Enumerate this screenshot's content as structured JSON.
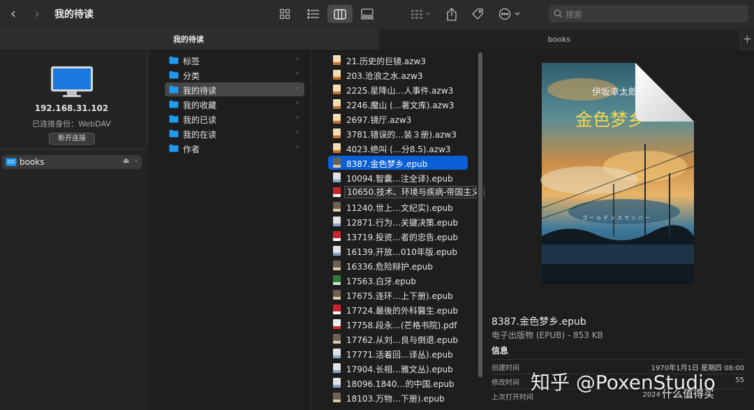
{
  "window": {
    "title": "我的待读"
  },
  "search": {
    "placeholder": "搜索"
  },
  "tabs": [
    {
      "label": "我的待读",
      "active": true
    },
    {
      "label": "books",
      "active": false
    }
  ],
  "sidebar": {
    "server": {
      "host": "192.168.31.102",
      "connected_as": "已连接身份：WebDAV",
      "disconnect_label": "断开连接"
    },
    "items": [
      {
        "label": "books",
        "selected": true
      }
    ]
  },
  "column1": {
    "items": [
      {
        "label": "标签",
        "selected": false
      },
      {
        "label": "分类",
        "selected": false
      },
      {
        "label": "我的待读",
        "selected": true
      },
      {
        "label": "我的收藏",
        "selected": false
      },
      {
        "label": "我的已读",
        "selected": false
      },
      {
        "label": "我的在读",
        "selected": false
      },
      {
        "label": "作者",
        "selected": false
      }
    ]
  },
  "column2": {
    "items": [
      {
        "label": "21.历史的巨镜.azw3",
        "icon": "azw3"
      },
      {
        "label": "203.沧浪之水.azw3",
        "icon": "azw3"
      },
      {
        "label": "2225.星降山…人事件.azw3",
        "icon": "azw3"
      },
      {
        "label": "2246.魔山 (…著文库).azw3",
        "icon": "azw3"
      },
      {
        "label": "2697.镜厅.azw3",
        "icon": "azw3"
      },
      {
        "label": "3781.错误的…装３册).azw3",
        "icon": "azw3"
      },
      {
        "label": "4023.绝叫 (…分8.5).azw3",
        "icon": "azw3"
      },
      {
        "label": "8387.金色梦乡.epub",
        "icon": "epub-cover",
        "selected": true
      },
      {
        "label": "10094.智囊…注全译).epub",
        "icon": "epub"
      },
      {
        "label": "10650.技术、环境与疾病-帝国主义征服史.epub",
        "icon": "epub-red",
        "tooltip": true
      },
      {
        "label": "11240.世上…文纪实).epub",
        "icon": "epub-cover"
      },
      {
        "label": "12871.行为…关键决策.epub",
        "icon": "epub"
      },
      {
        "label": "13719.投资…者的忠告.epub",
        "icon": "epub-red"
      },
      {
        "label": "16139.开放…010年版.epub",
        "icon": "epub"
      },
      {
        "label": "16336.危险辩护.epub",
        "icon": "epub-cover"
      },
      {
        "label": "17563.白牙.epub",
        "icon": "epub-green"
      },
      {
        "label": "17675.连环…上下册).epub",
        "icon": "epub-cover"
      },
      {
        "label": "17724.最後的外科醫生.epub",
        "icon": "epub-red"
      },
      {
        "label": "17758.段永…(芒格书院).pdf",
        "icon": "pdf"
      },
      {
        "label": "17762.从刘…良与倒退.epub",
        "icon": "epub-cover"
      },
      {
        "label": "17771.活着回…译丛).epub",
        "icon": "epub"
      },
      {
        "label": "17904.长相…雅文丛).epub",
        "icon": "epub"
      },
      {
        "label": "18096.1840…的中国.epub",
        "icon": "epub"
      },
      {
        "label": "18103.万物…下册).epub",
        "icon": "epub-cover"
      }
    ]
  },
  "preview": {
    "cover_title": "金色梦乡",
    "cover_author": "伊坂幸太郎",
    "cover_subtitle": "ゴールデンスランバー",
    "file_name": "8387.金色梦乡.epub",
    "kind_size": "电子出版物 (EPUB) - 853 KB",
    "info_heading": "信息",
    "rows": [
      {
        "key": "创建时间",
        "value": "1970年1月1日 星期四 08:00"
      },
      {
        "key": "修改时间",
        "value": "55"
      },
      {
        "key": "上次打开时间",
        "value": "2024"
      }
    ]
  },
  "watermark": {
    "main": "知乎 @PoxenStudio",
    "sub": "什么值得买"
  },
  "colors": {
    "accent": "#0a5fd6",
    "folder": "#1e9bf0",
    "sidebar_bg": "#242424",
    "content_bg": "#1e1e1e"
  }
}
